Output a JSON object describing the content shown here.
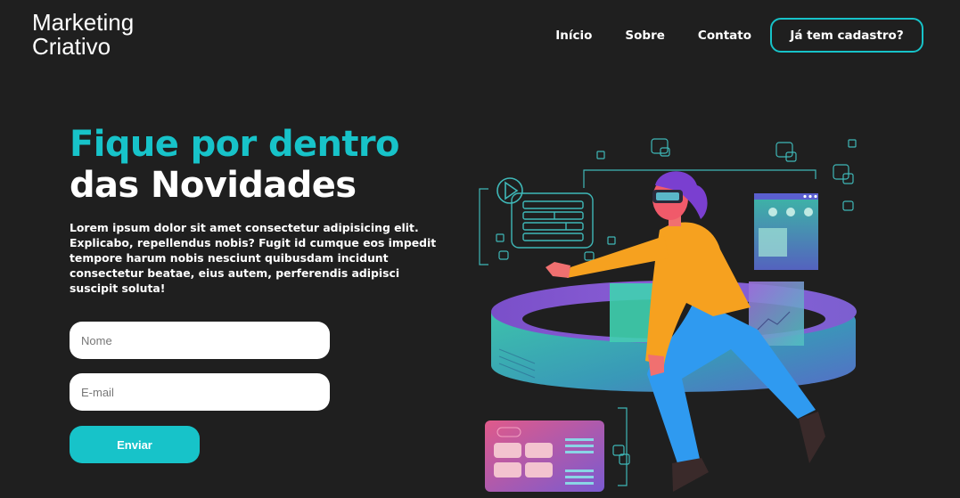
{
  "brand": {
    "line1": "Marketing",
    "line2": "Criativo"
  },
  "nav": {
    "links": [
      "Início",
      "Sobre",
      "Contato"
    ],
    "cta": "Já tem cadastro?"
  },
  "hero": {
    "title_accent": "Fique por dentro",
    "title_main": "das Novidades",
    "description": "Lorem ipsum dolor sit amet consectetur adipisicing elit. Explicabo, repellendus nobis? Fugit id cumque eos impedit tempore harum nobis nesciunt quibusdam incidunt consectetur beatae, eius autem, perferendis adipisci suscipit soluta!"
  },
  "form": {
    "name_placeholder": "Nome",
    "email_placeholder": "E-mail",
    "submit_label": "Enviar"
  },
  "colors": {
    "background": "#1f1f1f",
    "accent": "#17c3c9",
    "text": "#ffffff"
  }
}
